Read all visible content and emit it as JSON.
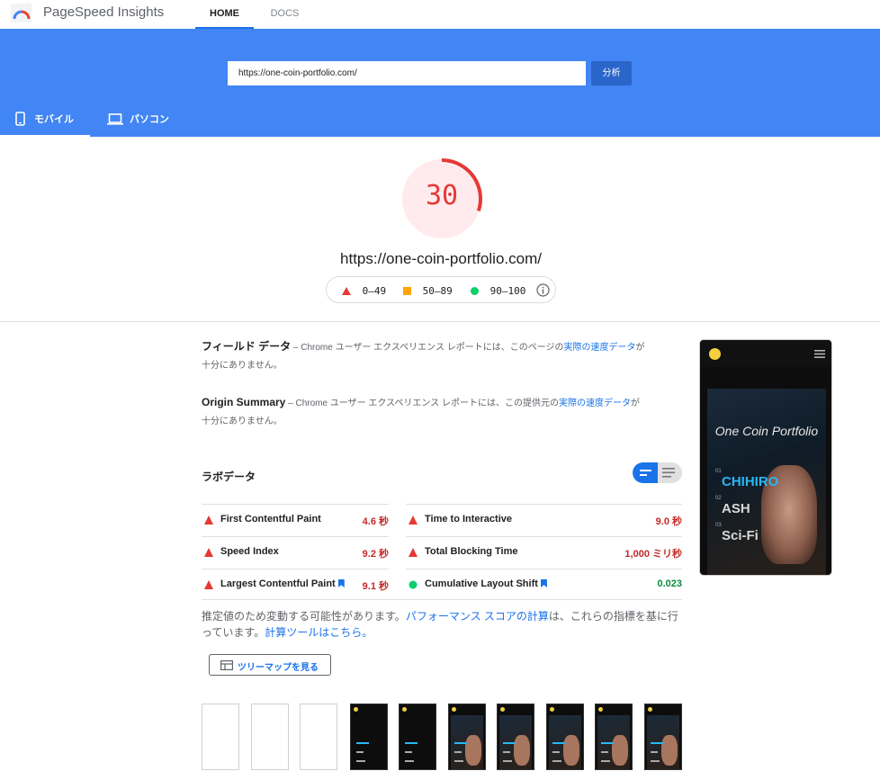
{
  "app": {
    "title": "PageSpeed Insights"
  },
  "nav": {
    "home": "HOME",
    "docs": "DOCS"
  },
  "search": {
    "url": "https://one-coin-portfolio.com/",
    "analyze_label": "分析"
  },
  "device_tabs": {
    "mobile": "モバイル",
    "desktop": "パソコン"
  },
  "score": {
    "value": "30",
    "fraction": 0.3,
    "color": "#e53935"
  },
  "page_url": "https://one-coin-portfolio.com/",
  "legend": {
    "fail": "0–49",
    "average": "50–89",
    "pass": "90–100"
  },
  "field_data": {
    "title": "フィールド データ",
    "desc_prefix": " – Chrome ユーザー エクスペリエンス レポートには、このページの",
    "desc_link": "実際の速度データ",
    "desc_suffix": "が十分にありません。"
  },
  "origin_summary": {
    "title": "Origin Summary",
    "desc_prefix": " – Chrome ユーザー エクスペリエンス レポートには、この提供元の",
    "desc_link": "実際の速度データ",
    "desc_suffix": "が十分にありません。"
  },
  "lab_data": {
    "title": "ラボデータ"
  },
  "metrics_left": [
    {
      "name": "First Contentful Paint",
      "value": "4.6 秒",
      "status": "fail"
    },
    {
      "name": "Speed Index",
      "value": "9.2 秒",
      "status": "fail"
    },
    {
      "name": "Largest Contentful Paint",
      "value": "9.1 秒",
      "status": "fail"
    }
  ],
  "metrics_right": [
    {
      "name": "Time to Interactive",
      "value": "9.0 秒",
      "status": "fail"
    },
    {
      "name": "Total Blocking Time",
      "value": "1,000 ミリ秒",
      "status": "fail"
    },
    {
      "name": "Cumulative Layout Shift",
      "value": "0.023",
      "status": "pass"
    }
  ],
  "note": {
    "part1": "推定値のため変動する可能性があります。",
    "link1": "パフォーマンス スコアの計算",
    "part2": "は、これらの指標を基に行っています。",
    "link2": "計算ツールはこちら。"
  },
  "treemap_label": "ツリーマップを見る",
  "preview": {
    "site_title": "One Coin Portfolio",
    "items": [
      {
        "num": "01",
        "label": "CHIHIRO"
      },
      {
        "num": "02",
        "label": "ASH"
      },
      {
        "num": "03",
        "label": "Sci-Fi"
      }
    ]
  },
  "colors": {
    "brand": "#4285f4",
    "fail": "#e53935",
    "average": "#ffa400",
    "pass": "#0cce6b",
    "link": "#1a73e8"
  }
}
